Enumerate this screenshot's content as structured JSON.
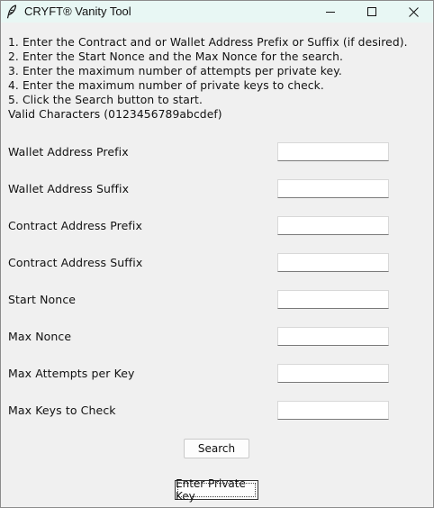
{
  "window": {
    "title": "CRYFT® Vanity Tool",
    "icon": "feather-icon",
    "controls": [
      "minimize-icon",
      "maximize-icon",
      "close-icon"
    ]
  },
  "instructions": [
    "1. Enter the Contract and or Wallet Address Prefix or Suffix (if desired).",
    "2. Enter the Start Nonce and the Max Nonce for the search.",
    "3. Enter the maximum number of attempts per private key.",
    "4. Enter the maximum number of private keys to check.",
    "5. Click the Search button to start.",
    "Valid Characters (0123456789abcdef)"
  ],
  "fields": [
    {
      "label": "Wallet Address Prefix",
      "value": ""
    },
    {
      "label": "Wallet Address Suffix",
      "value": ""
    },
    {
      "label": "Contract Address Prefix",
      "value": ""
    },
    {
      "label": "Contract Address Suffix",
      "value": ""
    },
    {
      "label": "Start Nonce",
      "value": ""
    },
    {
      "label": "Max Nonce",
      "value": ""
    },
    {
      "label": "Max Attempts per Key",
      "value": ""
    },
    {
      "label": "Max Keys to Check",
      "value": ""
    }
  ],
  "buttons": {
    "search": "Search",
    "enter_private_key": "Enter Private Key"
  }
}
